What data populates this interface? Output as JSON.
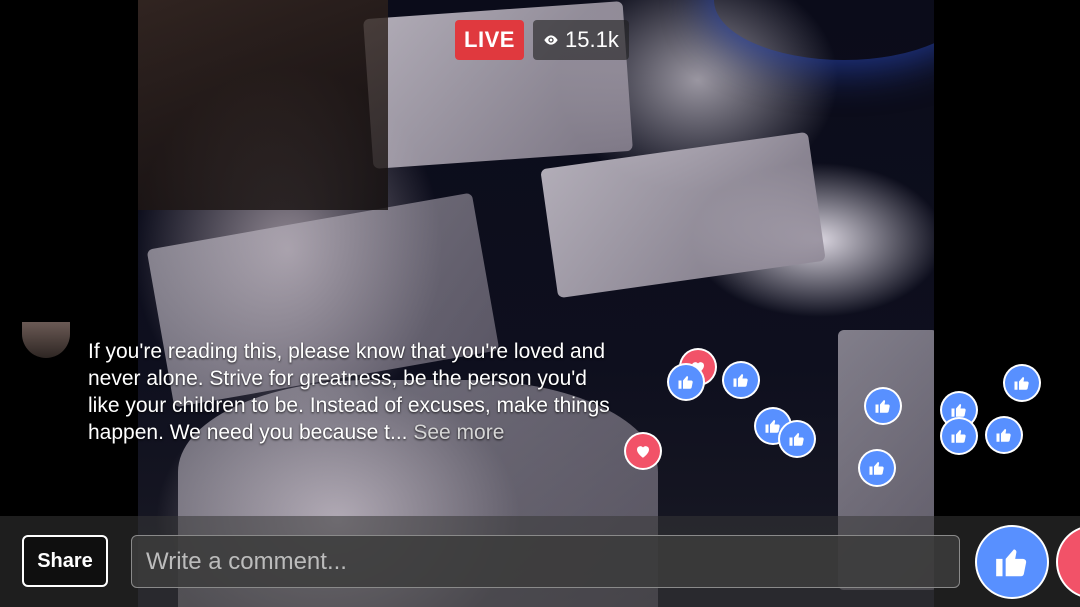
{
  "stream": {
    "live_label": "LIVE",
    "viewer_count": "15.1k"
  },
  "comment": {
    "text": "If you're reading this, please know that you're loved and never alone. Strive for greatness, be the person you'd like your children to be. Instead of excuses, make things happen. We need you because t...",
    "see_more": "See more"
  },
  "actions": {
    "share_label": "Share",
    "comment_placeholder": "Write a comment..."
  },
  "icons": {
    "viewers": "eye-icon",
    "like": "thumbs-up-icon",
    "love": "heart-icon"
  },
  "colors": {
    "live_red": "#e0393e",
    "like_blue": "#5890ff",
    "love_red": "#f25268"
  }
}
